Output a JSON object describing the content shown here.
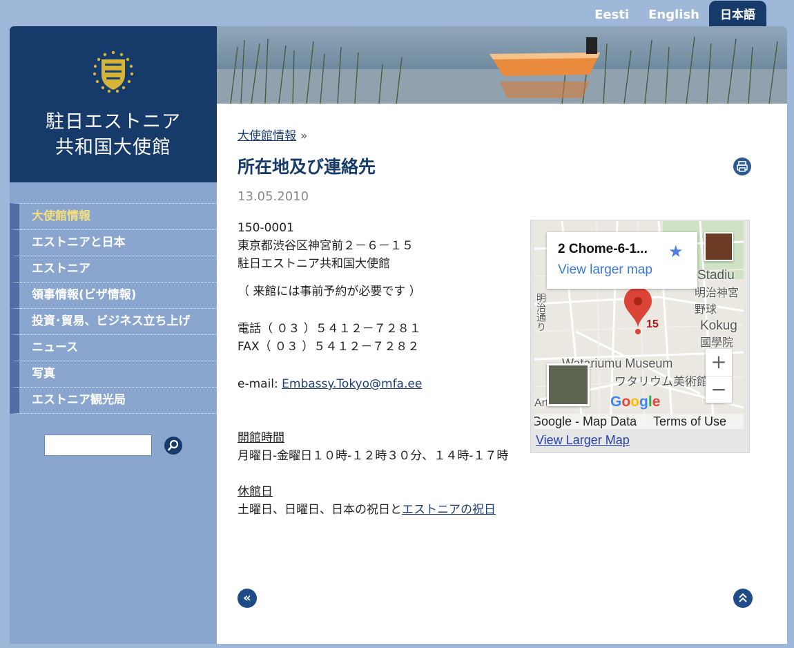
{
  "languages": [
    {
      "label": "Eesti",
      "active": false
    },
    {
      "label": "English",
      "active": false
    },
    {
      "label": "日本語",
      "active": true
    }
  ],
  "brand": {
    "title_line1": "駐日エストニア",
    "title_line2": "共和国大使館"
  },
  "sidebar": {
    "items": [
      {
        "label": "大使館情報",
        "active": true
      },
      {
        "label": "エストニアと日本",
        "active": false
      },
      {
        "label": "エストニア",
        "active": false
      },
      {
        "label": "領事情報(ビザ情報)",
        "active": false
      },
      {
        "label": "投資･貿易、ビジネス立ち上げ",
        "active": false
      },
      {
        "label": "ニュース",
        "active": false
      },
      {
        "label": "写真",
        "active": false
      },
      {
        "label": "エストニア観光局",
        "active": false
      }
    ],
    "search": {
      "value": "",
      "placeholder": ""
    }
  },
  "breadcrumb": {
    "link": "大使館情報",
    "separator": "»"
  },
  "page": {
    "title": "所在地及び連絡先",
    "date": "13.05.2010"
  },
  "contact": {
    "postal_code": "150-0001",
    "address": "東京都渋谷区神宮前２－６－１５",
    "name": "駐日エストニア共和国大使館",
    "note": "（ 来館には事前予約が必要です ）",
    "phone": "電話（ ０３ ）５４１２－７２８１",
    "fax": "FAX（ ０３ ）５４１２－７２８２",
    "email_label": "e-mail: ",
    "email": "Embassy.Tokyo@mfa.ee"
  },
  "hours": {
    "heading": "開館時間",
    "text": "月曜日-金曜日１０時-１２時３０分、１４時-１７時"
  },
  "closed": {
    "heading": "休館日",
    "text": "土曜日、日曜日、日本の祝日と",
    "link": "エストニアの祝日"
  },
  "map": {
    "info_title": "2 Chome-6-1...",
    "info_link": "View larger map",
    "pin_label": "15",
    "labels": {
      "stadium": "Stadiu",
      "stadium_jp": "明治神宮野球",
      "kokug": "Kokug",
      "kokug_jp": "國學院",
      "museum": "Watariumu Museum",
      "museum_jp": "ワタリウム美術館",
      "street": "明治通り",
      "left_edge": "Art"
    },
    "google_letters": [
      "G",
      "o",
      "o",
      "g",
      "l",
      "e"
    ],
    "google_colors": [
      "#4285f4",
      "#ea4335",
      "#fbbc05",
      "#4285f4",
      "#34a853",
      "#ea4335"
    ],
    "footer_data": "Google - Map Data",
    "footer_terms": "Terms of Use",
    "zoom_in": "+",
    "zoom_out": "−",
    "larger_link": "View Larger Map"
  },
  "colors": {
    "navy": "#163a6a",
    "sidebar": "#8aa6cf",
    "active_nav": "#f6e07d",
    "background": "#9fb8d9"
  },
  "icons": {
    "print": "printer-icon",
    "search": "magnifier-icon",
    "prev": "double-chevron-left-icon",
    "top": "double-chevron-up-icon"
  }
}
